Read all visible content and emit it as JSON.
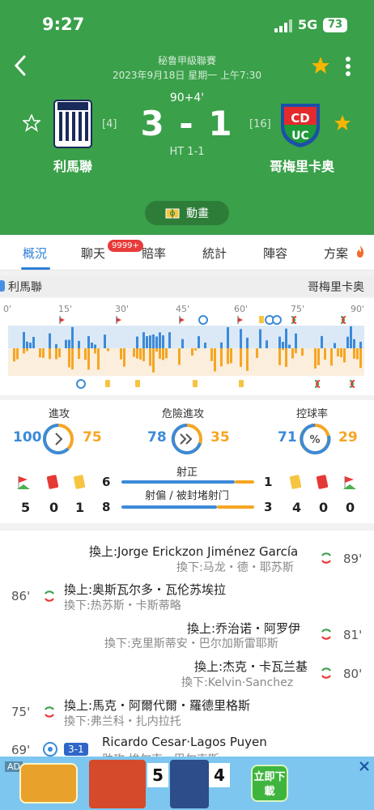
{
  "status_bar": {
    "time": "9:27",
    "network": "5G",
    "battery": "73"
  },
  "header": {
    "league": "秘鲁甲級聯賽",
    "datetime": "2023年9月18日 星期一 上午7:30",
    "added_time": "90+4'",
    "score": "3 - 1",
    "halftime": "HT 1-1",
    "home": {
      "name": "利馬聯",
      "rank": "[4]",
      "logo_text": "ALIANZA LIMA 1901"
    },
    "away": {
      "name": "哥梅里卡奥",
      "rank": "[16]",
      "logo_text": "CDUC"
    },
    "animation_label": "動畫"
  },
  "tabs": [
    {
      "label": "概況",
      "active": true
    },
    {
      "label": "聊天"
    },
    {
      "label": "賠率"
    },
    {
      "label": "統計"
    },
    {
      "label": "陣容"
    },
    {
      "label": "方案"
    }
  ],
  "chat_badge": "9999+",
  "timeline": {
    "home": "利馬聯",
    "away": "哥梅里卡奥",
    "ticks": [
      "0'",
      "15'",
      "30'",
      "45'",
      "60'",
      "75'",
      "90'"
    ]
  },
  "stats": {
    "attack": {
      "label": "進攻",
      "home": "100",
      "away": "75"
    },
    "dangerous": {
      "label": "危險進攻",
      "home": "78",
      "away": "35"
    },
    "possession": {
      "label": "控球率",
      "home": "71",
      "away": "29",
      "symbol": "%"
    },
    "shots_on_label": "射正",
    "shots_off_label": "射偏 / 被封堵射门",
    "shots_on": {
      "home": "6",
      "away": "1"
    },
    "shots_off": {
      "home": "8",
      "away": "3"
    },
    "home_counts": {
      "corners": "5",
      "red": "0",
      "yellow": "1"
    },
    "away_counts": {
      "yellow": "4",
      "red": "0",
      "corners": "0"
    }
  },
  "events": [
    {
      "minute": "89'",
      "in": "換上:Jorge Erickzon Jiménez García",
      "out": "換下:马龙・德・耶苏斯"
    },
    {
      "minute": "86'",
      "in": "換上:奥斯瓦尔多・瓦伦苏埃拉",
      "out": "換下:热苏斯・卡斯蒂略"
    },
    {
      "minute": "81'",
      "in": "換上:乔治诺・阿罗伊",
      "out": "換下:克里斯蒂安・巴尔加斯雷耶斯"
    },
    {
      "minute": "80'",
      "in": "換上:杰克・卡瓦兰基",
      "out": "換下:Kelvin·Sanchez"
    },
    {
      "minute": "75'",
      "in": "換上:馬克・阿爾代爾・羅德里格斯",
      "out": "換下:弗兰科・扎内拉托"
    },
    {
      "minute": "69'",
      "score": "3-1",
      "scorer": "Ricardo Cesar·Lagos Puyen",
      "assist": "助攻:埃尔南・巴尔克斯"
    }
  ],
  "ad": {
    "tag": "AD",
    "cta": "立即下載",
    "numbers": [
      "5",
      "4"
    ]
  }
}
